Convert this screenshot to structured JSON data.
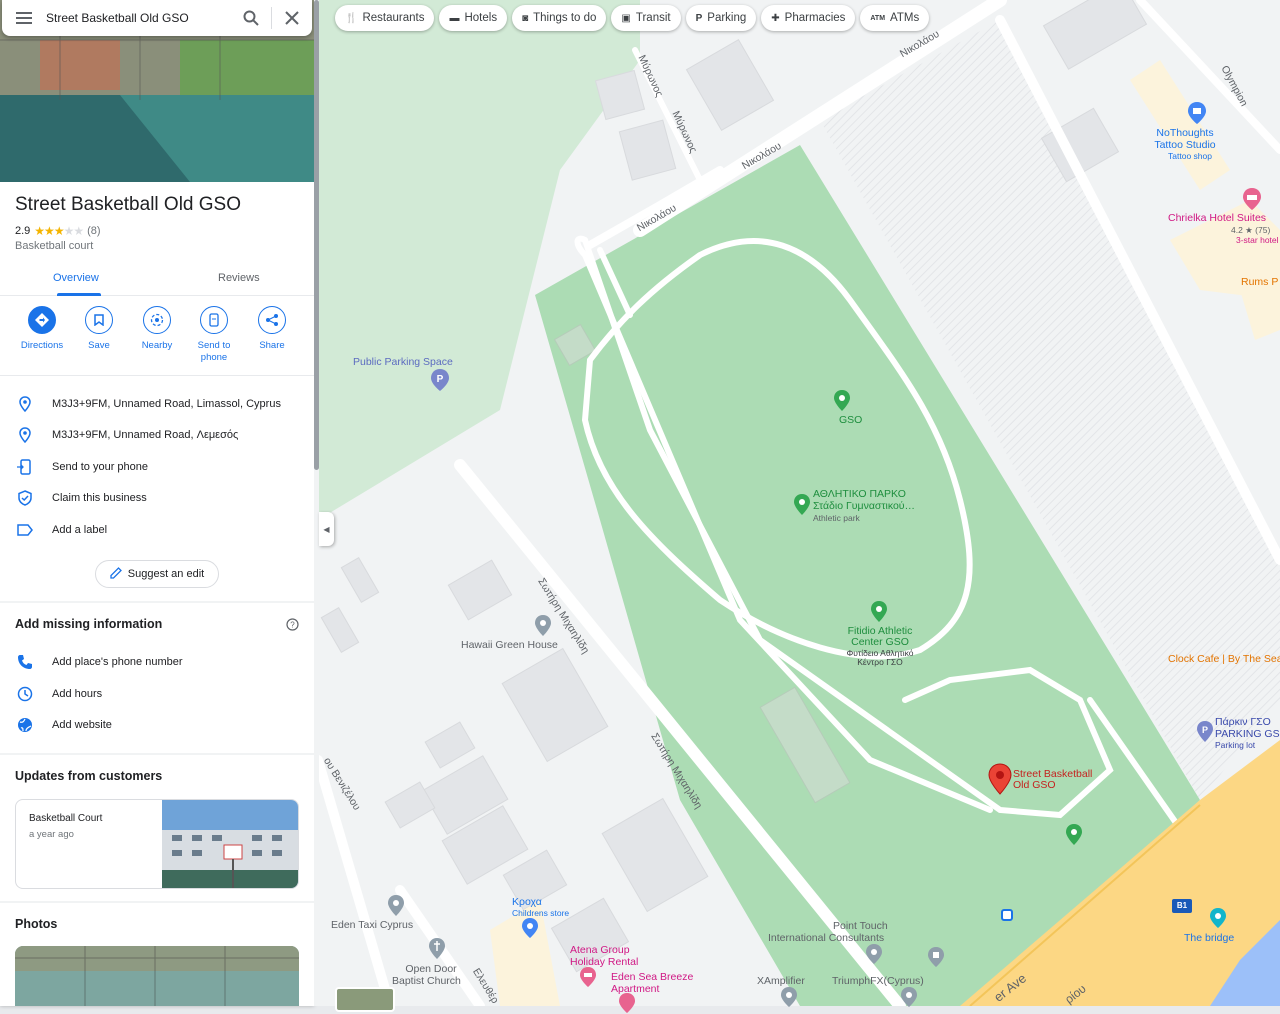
{
  "search": {
    "query": "Street Basketball Old GSO"
  },
  "place": {
    "title": "Street Basketball Old GSO",
    "rating": "2.9",
    "review_count": "(8)",
    "stars": 3,
    "category": "Basketball court"
  },
  "tabs": [
    {
      "label": "Overview",
      "active": true
    },
    {
      "label": "Reviews",
      "active": false
    }
  ],
  "actions": [
    {
      "label": "Directions",
      "icon": "directions-icon"
    },
    {
      "label": "Save",
      "icon": "bookmark-icon"
    },
    {
      "label": "Nearby",
      "icon": "nearby-icon"
    },
    {
      "label": "Send to phone",
      "icon": "send-to-phone-icon"
    },
    {
      "label": "Share",
      "icon": "share-icon"
    }
  ],
  "info": [
    {
      "text": "M3J3+9FM, Unnamed Road, Limassol, Cyprus",
      "icon": "location-pin-icon"
    },
    {
      "text": "M3J3+9FM, Unnamed Road, Λεμεσός",
      "icon": "location-pin-icon"
    },
    {
      "text": "Send to your phone",
      "icon": "phone-send-icon"
    },
    {
      "text": "Claim this business",
      "icon": "shield-check-icon"
    },
    {
      "text": "Add a label",
      "icon": "label-icon"
    }
  ],
  "suggest_edit": "Suggest an edit",
  "missing": {
    "title": "Add missing information",
    "items": [
      {
        "text": "Add place's phone number",
        "icon": "phone-icon"
      },
      {
        "text": "Add hours",
        "icon": "clock-icon"
      },
      {
        "text": "Add website",
        "icon": "globe-icon"
      }
    ]
  },
  "updates": {
    "title": "Updates from customers",
    "card_title": "Basketball Court",
    "card_time": "a year ago"
  },
  "photos": {
    "title": "Photos"
  },
  "chips": [
    {
      "label": "Restaurants",
      "icon": "fork-knife-icon"
    },
    {
      "label": "Hotels",
      "icon": "bed-icon"
    },
    {
      "label": "Things to do",
      "icon": "camera-icon"
    },
    {
      "label": "Transit",
      "icon": "bus-icon"
    },
    {
      "label": "Parking",
      "icon": "parking-icon"
    },
    {
      "label": "Pharmacies",
      "icon": "pharmacy-icon"
    },
    {
      "label": "ATMs",
      "icon": "atm-icon"
    }
  ],
  "map": {
    "streets": {
      "nikolaou_1": "Νικολάου",
      "nikolaou_2": "Νικολάου",
      "nikolaou_3": "Νικολάου",
      "myronos_1": "Μύρωνος",
      "myronos_2": "Μύρωνος",
      "olympion": "Olympion",
      "sotiri_1": "Σωτήρη Μιχαηλίδη",
      "sotiri_2": "Σωτήρη Μιχαηλίδη",
      "venizelou": "ου Βενιζέλου",
      "eleftheriou": "Ελευθέρ",
      "ave": "er Ave",
      "oriou": "ρίου"
    },
    "places": {
      "public_parking": "Public Parking Space",
      "gso": "GSO",
      "athletic_park": "ΑΘΛΗΤΙΚΟ ΠΑΡΚΟ",
      "athletic_park_2": "Στάδιο Γυμναστικού…",
      "athletic_park_sub": "Athletic park",
      "fitidio_1": "Fitidio Athletic",
      "fitidio_2": "Center GSO",
      "fitidio_3": "Φυτίδειο Αθλητικό",
      "fitidio_4": "Κέντρο ΓΣΟ",
      "basketball_1": "Street Basketball",
      "basketball_2": "Old GSO",
      "hawaii": "Hawaii Green House",
      "nothoughts_1": "NoThoughts",
      "nothoughts_2": "Tattoo Studio",
      "nothoughts_sub": "Tattoo shop",
      "chrielka": "Chrielka Hotel Suites",
      "chrielka_rating": "4.2 ★ (75)",
      "chrielka_sub": "3-star hotel",
      "rums": "Rums P",
      "clock_cafe": "Clock Cafe | By The Sea",
      "parking_gso_1": "Πάρκιν ΓΣΟ",
      "parking_gso_2": "PARKING GSO",
      "parking_gso_sub": "Parking lot",
      "kroxa": "Κροχα",
      "kroxa_sub": "Childrens store",
      "eden_taxi": "Eden Taxi Cyprus",
      "open_door_1": "Open Door",
      "open_door_2": "Baptist Church",
      "atena_1": "Atena Group",
      "atena_2": "Holiday Rental",
      "eden_sea_1": "Eden Sea Breeze",
      "eden_sea_2": "Apartment",
      "point_touch_1": "Point Touch",
      "point_touch_2": "International Consultants",
      "xamplifier": "XAmplifier",
      "triumph": "TriumphFX(Cyprus)",
      "the_bridge": "The bridge",
      "b1": "B1"
    },
    "colors": {
      "park": "#acdcb4",
      "land": "#f1f3f4",
      "road": "#ffffff",
      "highway": "#fcd784",
      "water": "#9cc0f9",
      "marker_red": "#ea4335",
      "marker_green": "#34a853"
    }
  }
}
